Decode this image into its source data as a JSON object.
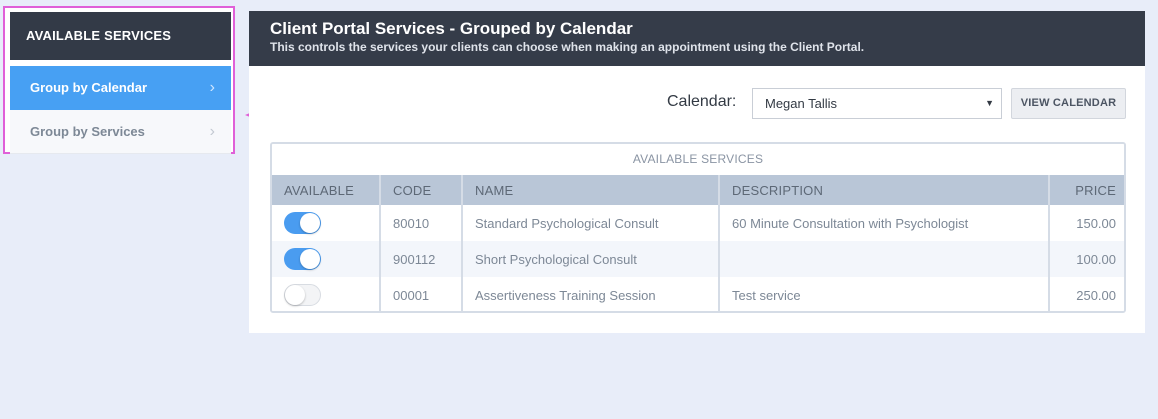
{
  "sidebar": {
    "header": "AVAILABLE SERVICES",
    "items": [
      {
        "label": "Group by Calendar",
        "active": true
      },
      {
        "label": "Group by Services",
        "active": false
      }
    ],
    "chevron": "›"
  },
  "panel": {
    "title": "Client Portal Services - Grouped by Calendar",
    "subtitle": "This controls the services your clients can choose when making an appointment using the Client Portal."
  },
  "calendar": {
    "label": "Calendar:",
    "selected": "Megan Tallis",
    "caret": "▼",
    "view_button": "VIEW CALENDAR"
  },
  "table": {
    "caption": "AVAILABLE SERVICES",
    "columns": [
      "AVAILABLE",
      "CODE",
      "NAME",
      "DESCRIPTION",
      "PRICE"
    ],
    "rows": [
      {
        "available": true,
        "code": "80010",
        "name": "Standard Psychological Consult",
        "description": "60 Minute Consultation with Psychologist",
        "price": "150.00"
      },
      {
        "available": true,
        "code": "900112",
        "name": "Short Psychological Consult",
        "description": "",
        "price": "100.00"
      },
      {
        "available": false,
        "code": "00001",
        "name": "Assertiveness Training Session",
        "description": "Test service",
        "price": "250.00"
      }
    ]
  },
  "colors": {
    "accent": "#47a0f3",
    "header_dark": "#353c49",
    "highlight_annotation": "#e060d8"
  }
}
